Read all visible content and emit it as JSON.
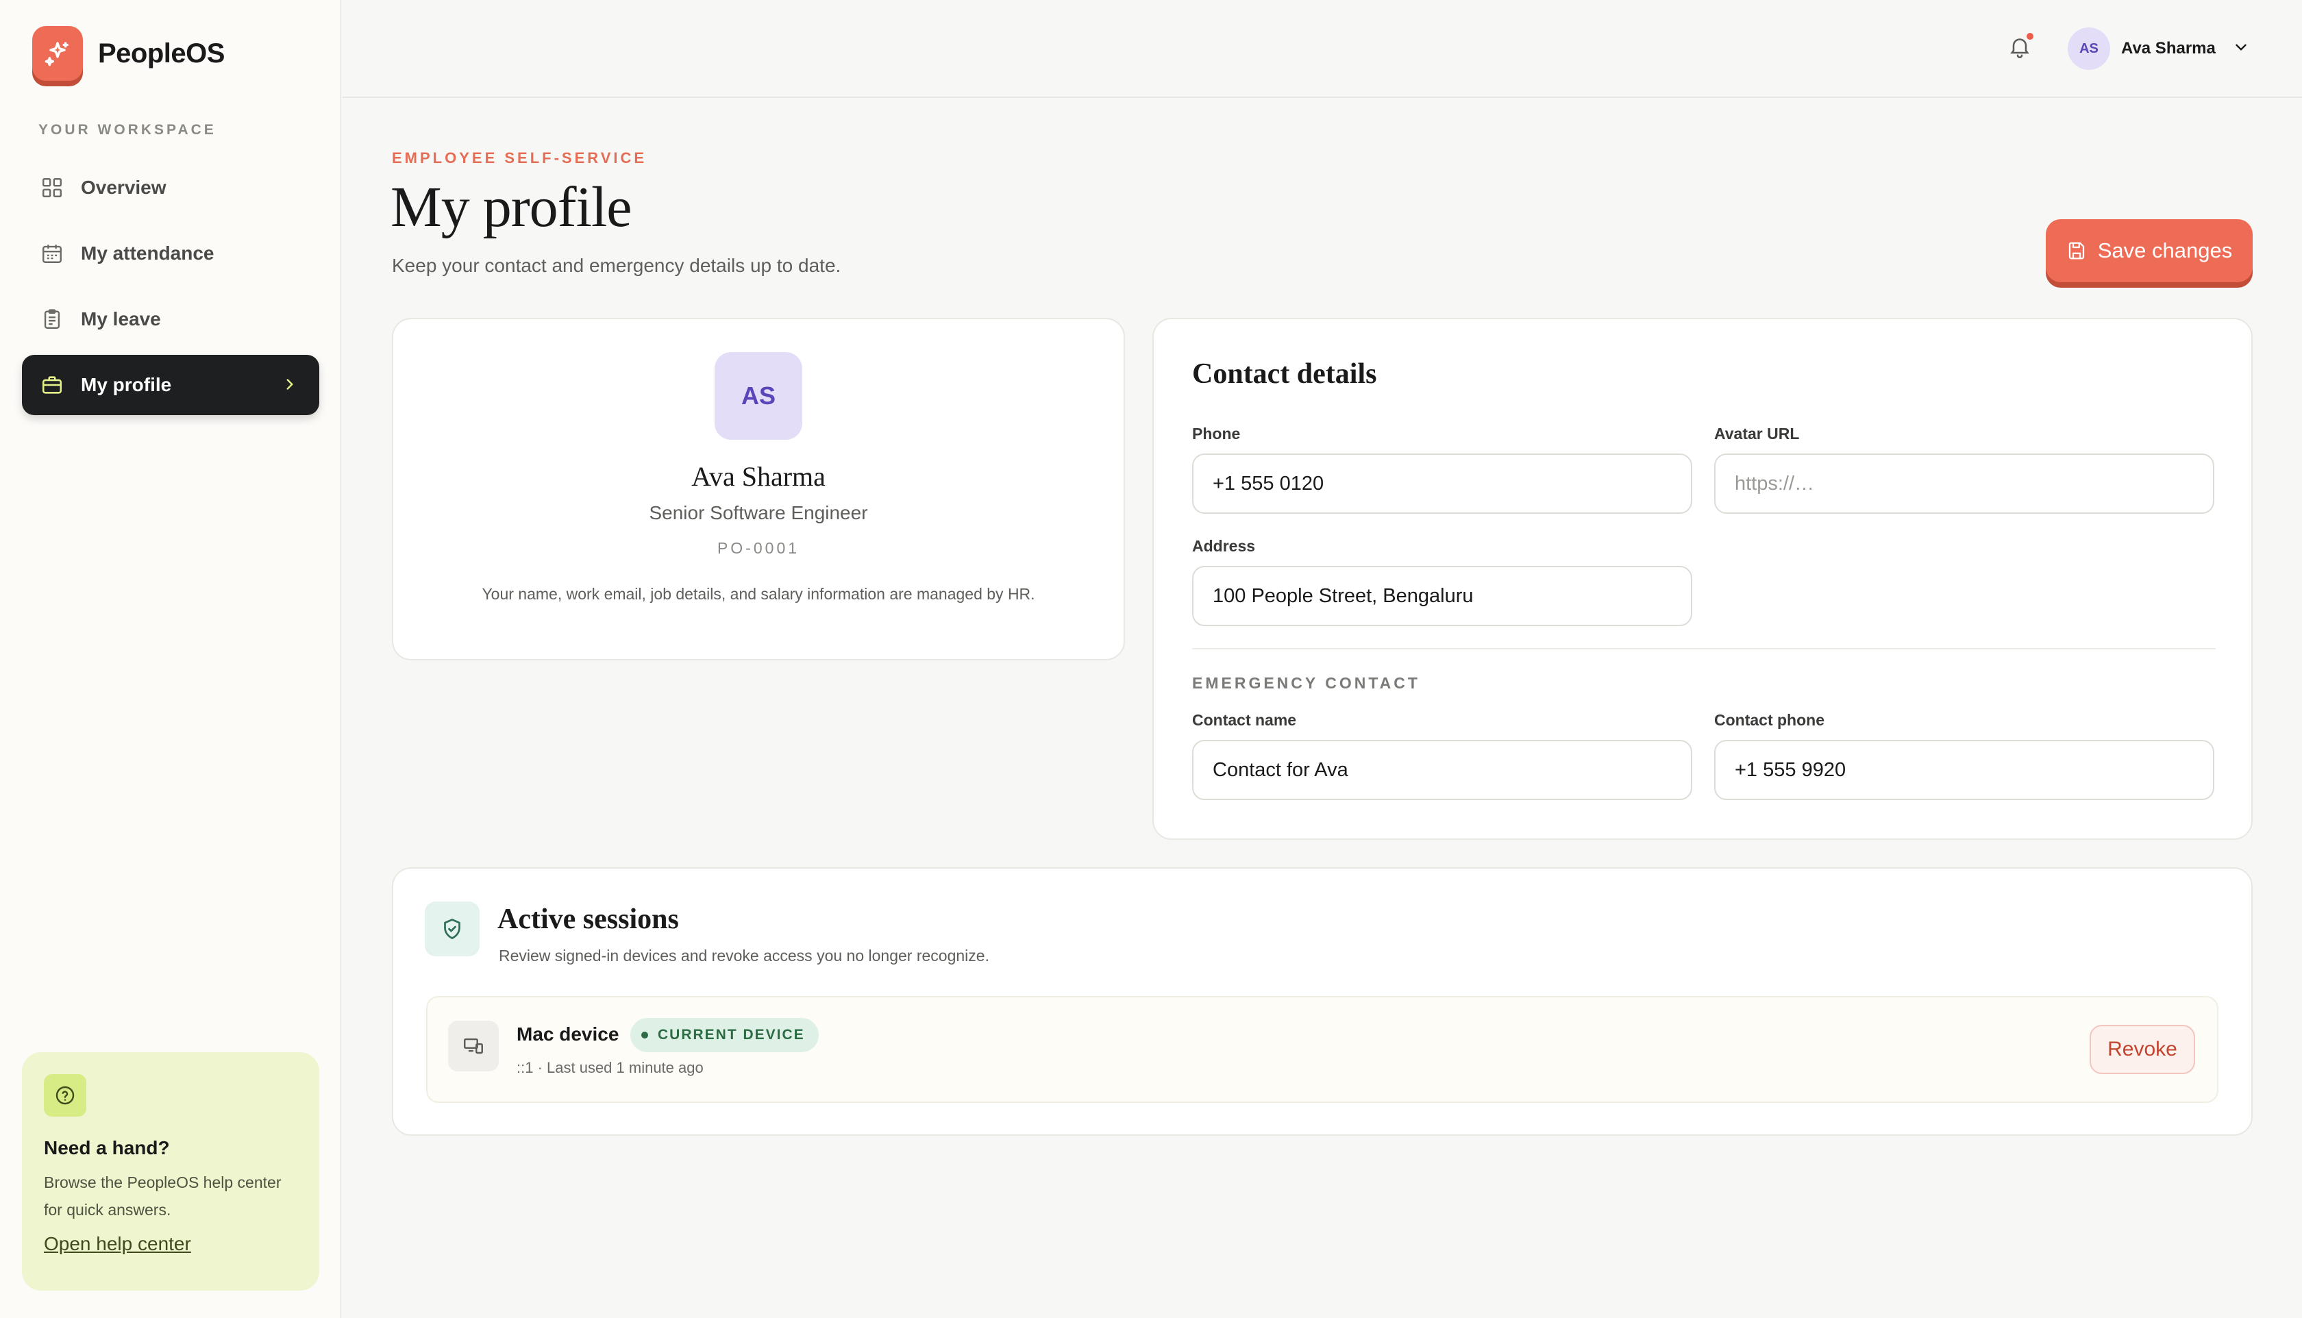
{
  "brand": {
    "name": "PeopleOS",
    "logo_icon": "sparkle-icon",
    "accent": "#ee6b55"
  },
  "sidebar": {
    "section_label": "YOUR WORKSPACE",
    "items": [
      {
        "label": "Overview",
        "icon": "grid-icon"
      },
      {
        "label": "My attendance",
        "icon": "calendar-icon"
      },
      {
        "label": "My leave",
        "icon": "clipboard-icon"
      },
      {
        "label": "My profile",
        "icon": "briefcase-icon",
        "active": true
      }
    ],
    "help": {
      "title": "Need a hand?",
      "text": "Browse the PeopleOS help center for quick answers.",
      "link": "Open help center"
    }
  },
  "topbar": {
    "user_initials": "AS",
    "user_name": "Ava Sharma",
    "has_notification": true
  },
  "header": {
    "eyebrow": "EMPLOYEE SELF-SERVICE",
    "title": "My profile",
    "subtitle": "Keep your contact and emergency details up to date.",
    "save_label": "Save changes"
  },
  "profile": {
    "initials": "AS",
    "name": "Ava Sharma",
    "role": "Senior Software Engineer",
    "employee_id": "PO-0001",
    "note": "Your name, work email, job details, and salary information are managed by HR."
  },
  "contact": {
    "title": "Contact details",
    "phone_label": "Phone",
    "phone_value": "+1 555 0120",
    "avatar_label": "Avatar URL",
    "avatar_placeholder": "https://…",
    "address_label": "Address",
    "address_value": "100 People Street, Bengaluru",
    "emergency_label": "EMERGENCY CONTACT",
    "contact_name_label": "Contact name",
    "contact_name_value": "Contact for Ava",
    "contact_phone_label": "Contact phone",
    "contact_phone_value": "+1 555 9920"
  },
  "sessions": {
    "title": "Active sessions",
    "subtitle": "Review signed-in devices and revoke access you no longer recognize.",
    "devices": [
      {
        "name": "Mac device",
        "badge": "CURRENT DEVICE",
        "meta": "::1 · Last used 1 minute ago",
        "action": "Revoke"
      }
    ]
  }
}
